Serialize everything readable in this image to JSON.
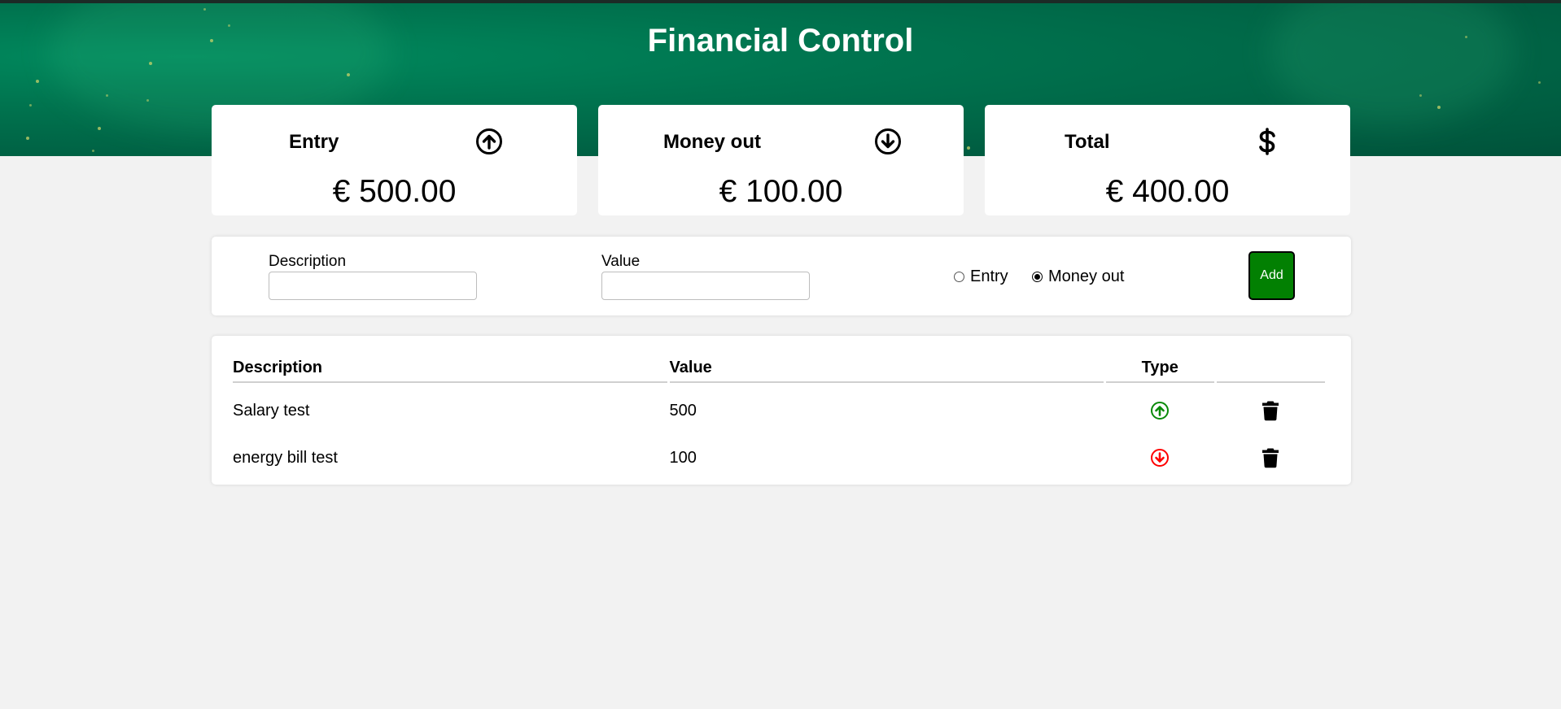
{
  "app": {
    "title": "Financial Control"
  },
  "summary": [
    {
      "label": "Entry",
      "icon": "arrow-up-circle-icon",
      "value": "€ 500.00"
    },
    {
      "label": "Money out",
      "icon": "arrow-down-circle-icon",
      "value": "€ 100.00"
    },
    {
      "label": "Total",
      "icon": "dollar-sign-icon",
      "value": "€ 400.00"
    }
  ],
  "form": {
    "description_label": "Description",
    "description_value": "",
    "value_label": "Value",
    "value_value": "",
    "radio_entry_label": "Entry",
    "radio_out_label": "Money out",
    "selected_type": "Money out",
    "add_label": "Add"
  },
  "table": {
    "headers": [
      "Description",
      "Value",
      "Type",
      ""
    ],
    "rows": [
      {
        "description": "Salary test",
        "value": "500",
        "type": "entry",
        "type_icon": "arrow-up-circle-icon",
        "action_icon": "trash-icon"
      },
      {
        "description": "energy bill test",
        "value": "100",
        "type": "money out",
        "type_icon": "arrow-down-circle-icon",
        "action_icon": "trash-icon"
      }
    ]
  },
  "colors": {
    "header_green": "#006b4a",
    "add_button": "#028002",
    "entry_icon": "#0a8a0a",
    "out_icon": "#ff0000",
    "background": "#f2f2f2"
  }
}
